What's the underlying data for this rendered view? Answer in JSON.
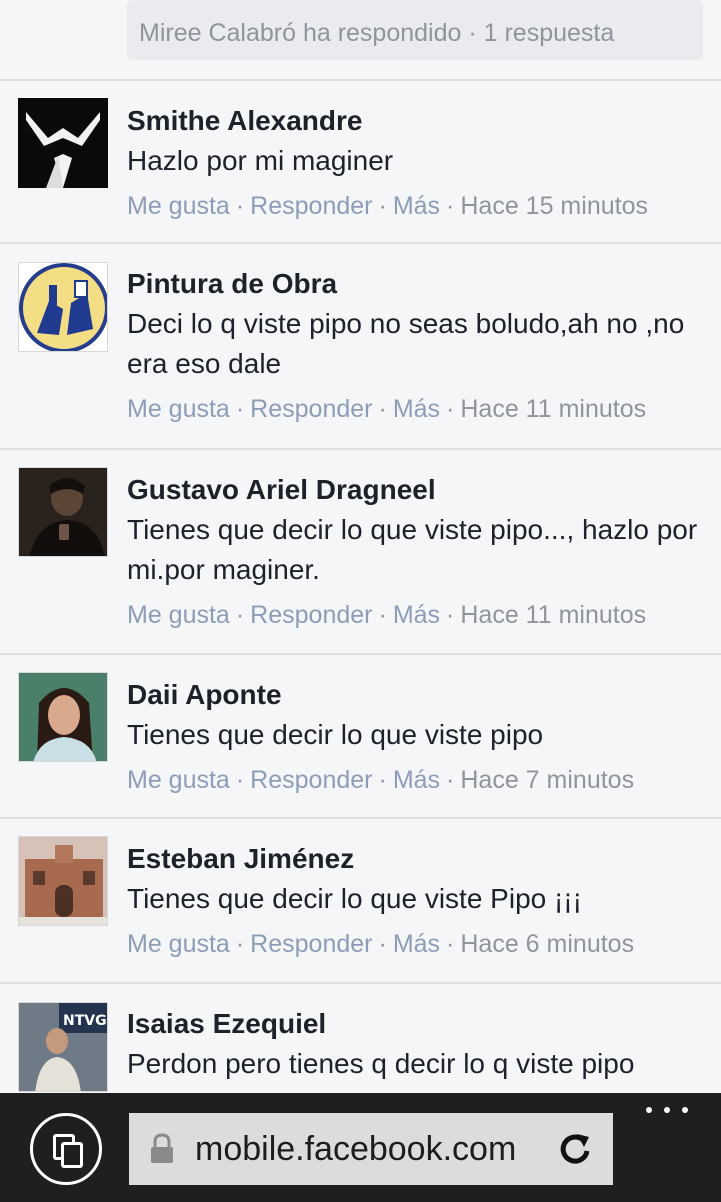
{
  "reply_summary": "Miree Calabró ha respondido · 1 respuesta",
  "actions": {
    "like": "Me gusta",
    "reply": "Responder",
    "more": "Más",
    "sep": "·"
  },
  "comments": [
    {
      "name": "Smithe Alexandre",
      "text": "Hazlo por mi maginer",
      "time": "Hace 15 minutos"
    },
    {
      "name": "Pintura de Obra",
      "text": "Deci lo q viste pipo no seas boludo,ah no ,no era eso dale",
      "time": "Hace 11 minutos"
    },
    {
      "name": "Gustavo Ariel Dragneel",
      "text": "Tienes que decir lo que viste pipo..., hazlo por mi.por maginer.",
      "time": "Hace 11 minutos"
    },
    {
      "name": "Daii Aponte",
      "text": "Tienes que decir lo que viste pipo",
      "time": "Hace 7 minutos"
    },
    {
      "name": "Esteban Jiménez",
      "text": "Tienes que decir lo que viste Pipo ¡¡¡",
      "time": "Hace 6 minutos"
    },
    {
      "name": "Isaias Ezequiel",
      "text": "Perdon pero tienes q decir lo q viste pipo",
      "time": ""
    }
  ],
  "avatar_badge": "NTVG",
  "browser": {
    "url": "mobile.facebook.com"
  },
  "colors": {
    "link_gray": "#8d9db8",
    "meta_gray": "#90949c",
    "text": "#1d2129",
    "bar": "#1f1f1f"
  },
  "icons": [
    "tabs-icon",
    "lock-icon",
    "refresh-icon",
    "more-icon"
  ]
}
